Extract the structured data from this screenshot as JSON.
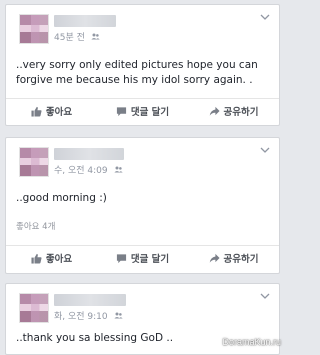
{
  "posts": [
    {
      "time": "45분 전",
      "text": "..very sorry only edited pictures hope you can forgive me  because his my idol sorry again. .",
      "likes_count": "",
      "actions": {
        "like": "좋아요",
        "comment": "댓글 달기",
        "share": "공유하기"
      }
    },
    {
      "time": "수, 오전 4:09",
      "text": "..good morning :)",
      "likes_count": "좋아요 4개",
      "actions": {
        "like": "좋아요",
        "comment": "댓글 달기",
        "share": "공유하기"
      }
    },
    {
      "time": "화, 오전 9:10",
      "text": "..thank you sa blessing GoD ..",
      "likes_count": "",
      "actions": null
    }
  ],
  "watermark": "DoramaKun.ru",
  "colors": {
    "background": "#e6e8ec",
    "card": "#ffffff",
    "meta_text": "#9197a3",
    "action_text": "#4b4f56"
  },
  "icons": [
    "audience-friends-icon",
    "chevron-down-icon",
    "thumbs-up-icon",
    "comment-bubble-icon",
    "share-arrow-icon"
  ]
}
